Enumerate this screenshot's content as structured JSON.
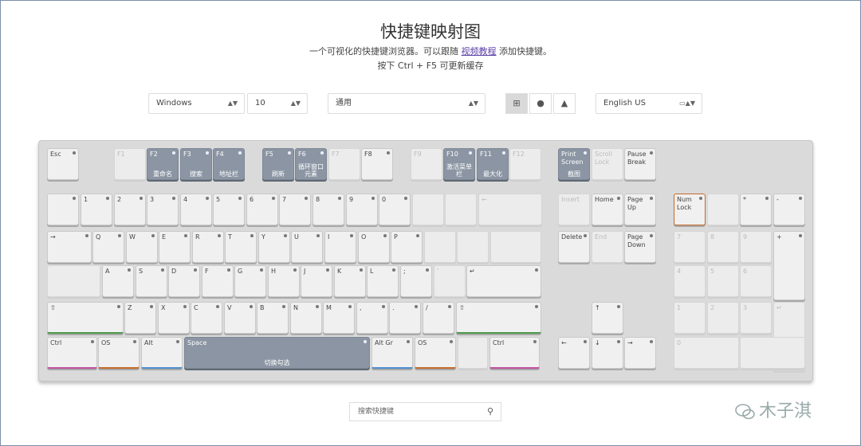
{
  "header": {
    "title": "快捷键映射图",
    "line1_pre": "一个可视化的快捷键浏览器。可以跟随",
    "line1_link": "视频教程",
    "line1_post": "添加快捷键。",
    "line2": "按下 Ctrl + F5 可更新缓存"
  },
  "controls": {
    "os": "Windows",
    "version": "10",
    "app": "通用",
    "layout": "English US",
    "os_icons": [
      "windows-icon",
      "apple-icon",
      "linux-icon"
    ]
  },
  "keys": {
    "r0": [
      {
        "l": "Esc"
      },
      {
        "l": "F1",
        "dim": 1
      },
      {
        "l": "F2",
        "a": "重命名"
      },
      {
        "l": "F3",
        "a": "搜索"
      },
      {
        "l": "F4",
        "a": "地址栏"
      },
      {
        "l": "F5",
        "a": "刷新"
      },
      {
        "l": "F6",
        "a": "循环窗口元素"
      },
      {
        "l": "F7",
        "dim": 1
      },
      {
        "l": "F8"
      },
      {
        "l": "F9",
        "dim": 1
      },
      {
        "l": "F10",
        "a": "激活菜单栏"
      },
      {
        "l": "F11",
        "a": "最大化"
      },
      {
        "l": "F12",
        "dim": 1
      },
      {
        "l": "Print Screen",
        "a": "截图"
      },
      {
        "l": "Scroll Lock",
        "dim": 1
      },
      {
        "l": "Pause Break"
      }
    ],
    "r1": [
      {
        "l": ""
      },
      {
        "l": "1"
      },
      {
        "l": "2"
      },
      {
        "l": "3"
      },
      {
        "l": "4"
      },
      {
        "l": "5"
      },
      {
        "l": "6"
      },
      {
        "l": "7"
      },
      {
        "l": "8"
      },
      {
        "l": "9"
      },
      {
        "l": "0"
      },
      {
        "l": "",
        "dim": 1
      },
      {
        "l": "",
        "dim": 1
      },
      {
        "l": "←",
        "dim": 1
      },
      {
        "l": "Insert",
        "dim": 1
      },
      {
        "l": "Home"
      },
      {
        "l": "Page Up"
      },
      {
        "l": "Num Lock"
      },
      {
        "l": "",
        "dim": 1
      },
      {
        "l": "*"
      },
      {
        "l": "-"
      }
    ],
    "r2": [
      {
        "l": "→"
      },
      {
        "l": "Q"
      },
      {
        "l": "W"
      },
      {
        "l": "E"
      },
      {
        "l": "R"
      },
      {
        "l": "T"
      },
      {
        "l": "Y"
      },
      {
        "l": "U"
      },
      {
        "l": "I"
      },
      {
        "l": "O"
      },
      {
        "l": "P"
      },
      {
        "l": "",
        "dim": 1
      },
      {
        "l": "",
        "dim": 1
      },
      {
        "l": "",
        "dim": 1
      },
      {
        "l": "Delete"
      },
      {
        "l": "End",
        "dim": 1
      },
      {
        "l": "Page Down"
      },
      {
        "l": "7",
        "dim": 1
      },
      {
        "l": "8",
        "dim": 1
      },
      {
        "l": "9",
        "dim": 1
      },
      {
        "l": "+"
      }
    ],
    "r3": [
      {
        "l": "",
        "dim": 1
      },
      {
        "l": "A"
      },
      {
        "l": "S"
      },
      {
        "l": "D"
      },
      {
        "l": "F"
      },
      {
        "l": "G"
      },
      {
        "l": "H"
      },
      {
        "l": "J"
      },
      {
        "l": "K"
      },
      {
        "l": "L"
      },
      {
        "l": ";"
      },
      {
        "l": "'",
        "dim": 1
      },
      {
        "l": "↵"
      },
      {
        "l": "4",
        "dim": 1
      },
      {
        "l": "5",
        "dim": 1
      },
      {
        "l": "6",
        "dim": 1
      }
    ],
    "r4": [
      {
        "l": "⇧"
      },
      {
        "l": "Z"
      },
      {
        "l": "X"
      },
      {
        "l": "C"
      },
      {
        "l": "V"
      },
      {
        "l": "B"
      },
      {
        "l": "N"
      },
      {
        "l": "M"
      },
      {
        "l": ","
      },
      {
        "l": "."
      },
      {
        "l": "/"
      },
      {
        "l": "⇧"
      },
      {
        "l": "↑"
      },
      {
        "l": "1",
        "dim": 1
      },
      {
        "l": "2",
        "dim": 1
      },
      {
        "l": "3",
        "dim": 1
      },
      {
        "l": "↵",
        "dim": 1
      }
    ],
    "r5": [
      {
        "l": "Ctrl"
      },
      {
        "l": "OS"
      },
      {
        "l": "Alt"
      },
      {
        "l": "Space",
        "a": "切换勾选"
      },
      {
        "l": "Alt Gr"
      },
      {
        "l": "OS"
      },
      {
        "l": "",
        "dim": 1
      },
      {
        "l": "Ctrl"
      },
      {
        "l": "←"
      },
      {
        "l": "↓"
      },
      {
        "l": "→"
      },
      {
        "l": "0",
        "dim": 1
      },
      {
        "l": "",
        "dim": 1
      }
    ]
  },
  "search": {
    "placeholder": "搜索快捷键"
  },
  "watermark": "木子淇"
}
